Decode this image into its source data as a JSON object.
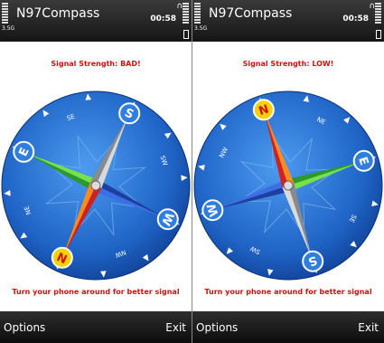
{
  "app_title": "N97Compass",
  "time": "00:58",
  "network_label": "3.5G",
  "left": {
    "signal": "Signal Strength: BAD!",
    "hint": "Turn your phone around for better signal",
    "heading_deg": 205,
    "minor_labels": [
      "NE",
      "SE",
      "SW",
      "NW"
    ],
    "majors": {
      "N": "N",
      "E": "E",
      "S": "S",
      "W": "W"
    }
  },
  "right": {
    "signal": "Signal Strength: LOW!",
    "hint": "Turn your phone around for better signal",
    "heading_deg": -18,
    "minor_labels": [
      "NE",
      "SE",
      "SW",
      "NW"
    ],
    "majors": {
      "N": "N",
      "E": "E",
      "S": "S",
      "W": "W"
    }
  },
  "softkeys": {
    "left": "Options",
    "right": "Exit"
  },
  "colors": {
    "signal_text": "#d01010",
    "dial": "#1f64c6",
    "north_badge": "#f5d200",
    "badge_letter": "#ffffff"
  }
}
